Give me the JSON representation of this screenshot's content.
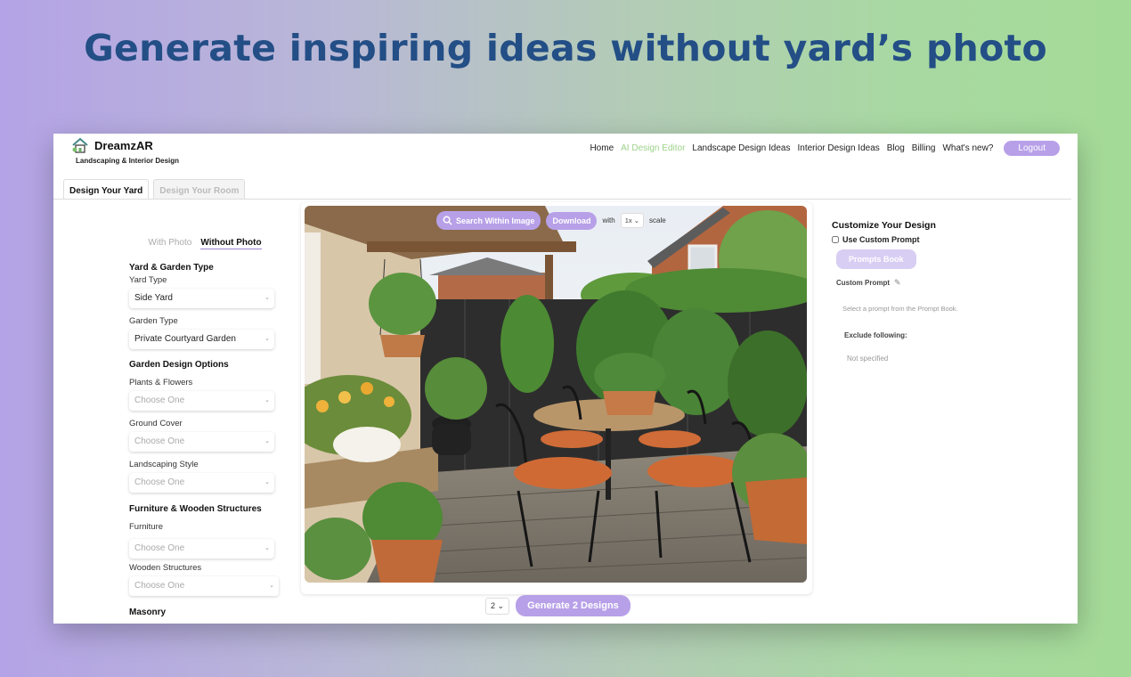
{
  "headline": "Generate inspiring ideas without yard’s photo",
  "brand": {
    "name": "DreamzAR",
    "tagline": "Landscaping & Interior Design",
    "logo_icon": "house-logo-icon"
  },
  "nav": {
    "items": [
      "Home",
      "AI Design Editor",
      "Landscape Design Ideas",
      "Interior Design Ideas",
      "Blog",
      "Billing",
      "What's new?"
    ],
    "active": "AI Design Editor",
    "logout": "Logout"
  },
  "tabs": [
    "Design Your Yard",
    "Design Your Room"
  ],
  "photo_toggle": {
    "with_photo": "With Photo",
    "without_photo": "Without Photo",
    "selected": "Without Photo"
  },
  "form": {
    "yard_section": "Yard & Garden Type",
    "yard_type_label": "Yard Type",
    "yard_type_value": "Side Yard",
    "garden_type_label": "Garden Type",
    "garden_type_value": "Private Courtyard Garden",
    "options_section": "Garden Design Options",
    "plants_label": "Plants & Flowers",
    "ground_label": "Ground Cover",
    "style_label": "Landscaping Style",
    "placeholder": "Choose One",
    "furniture_section": "Furniture & Wooden Structures",
    "furniture_label": "Furniture",
    "wooden_label": "Wooden Structures",
    "masonry_section": "Masonry"
  },
  "image_toolbar": {
    "search": "Search Within Image",
    "download": "Download",
    "with": "with",
    "scale_value": "1x",
    "scale": "scale"
  },
  "generate": {
    "count": "2",
    "button": "Generate 2 Designs"
  },
  "customize": {
    "title": "Customize Your Design",
    "use_custom_prompt": "Use Custom Prompt",
    "prompts_book": "Prompts Book",
    "custom_prompt_label": "Custom Prompt",
    "prompt_hint": "Select a prompt from the Prompt Book.",
    "exclude_label": "Exclude following:",
    "exclude_value": "Not specified"
  },
  "colors": {
    "accent": "#b7a0e8",
    "headline": "#234e86",
    "nav_active": "#9cd38a"
  }
}
